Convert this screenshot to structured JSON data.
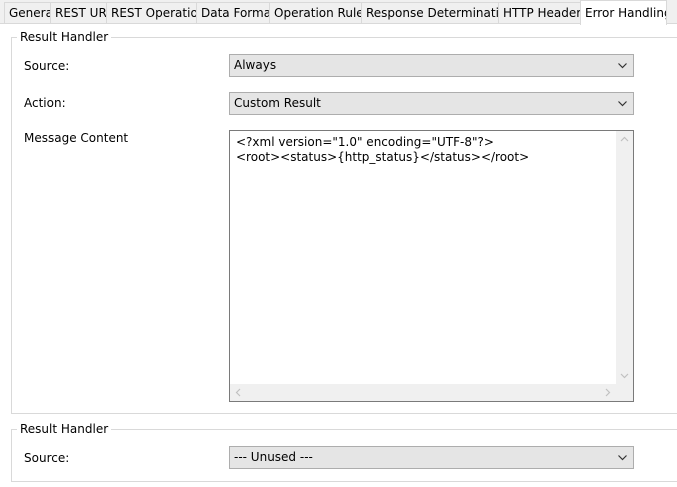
{
  "tabs": [
    {
      "label": "General",
      "active": false
    },
    {
      "label": "REST URL",
      "active": false
    },
    {
      "label": "REST Operation",
      "active": false
    },
    {
      "label": "Data Format",
      "active": false
    },
    {
      "label": "Operation Rules",
      "active": false
    },
    {
      "label": "Response Determination",
      "active": false
    },
    {
      "label": "HTTP Headers",
      "active": false
    },
    {
      "label": "Error Handling",
      "active": true
    }
  ],
  "handler1": {
    "title": "Result Handler",
    "source_label": "Source:",
    "source_value": "Always",
    "action_label": "Action:",
    "action_value": "Custom Result",
    "message_label": "Message Content",
    "message_content": "<?xml version=\"1.0\" encoding=\"UTF-8\"?>\n<root><status>{http_status}</status></root>"
  },
  "handler2": {
    "title": "Result Handler",
    "source_label": "Source:",
    "source_value": "--- Unused ---"
  },
  "icons": {
    "dropdown": "chevron-down-icon",
    "scroll_up": "scroll-up-arrow-icon",
    "scroll_down": "scroll-down-arrow-icon",
    "scroll_left": "scroll-left-arrow-icon",
    "scroll_right": "scroll-right-arrow-icon"
  }
}
